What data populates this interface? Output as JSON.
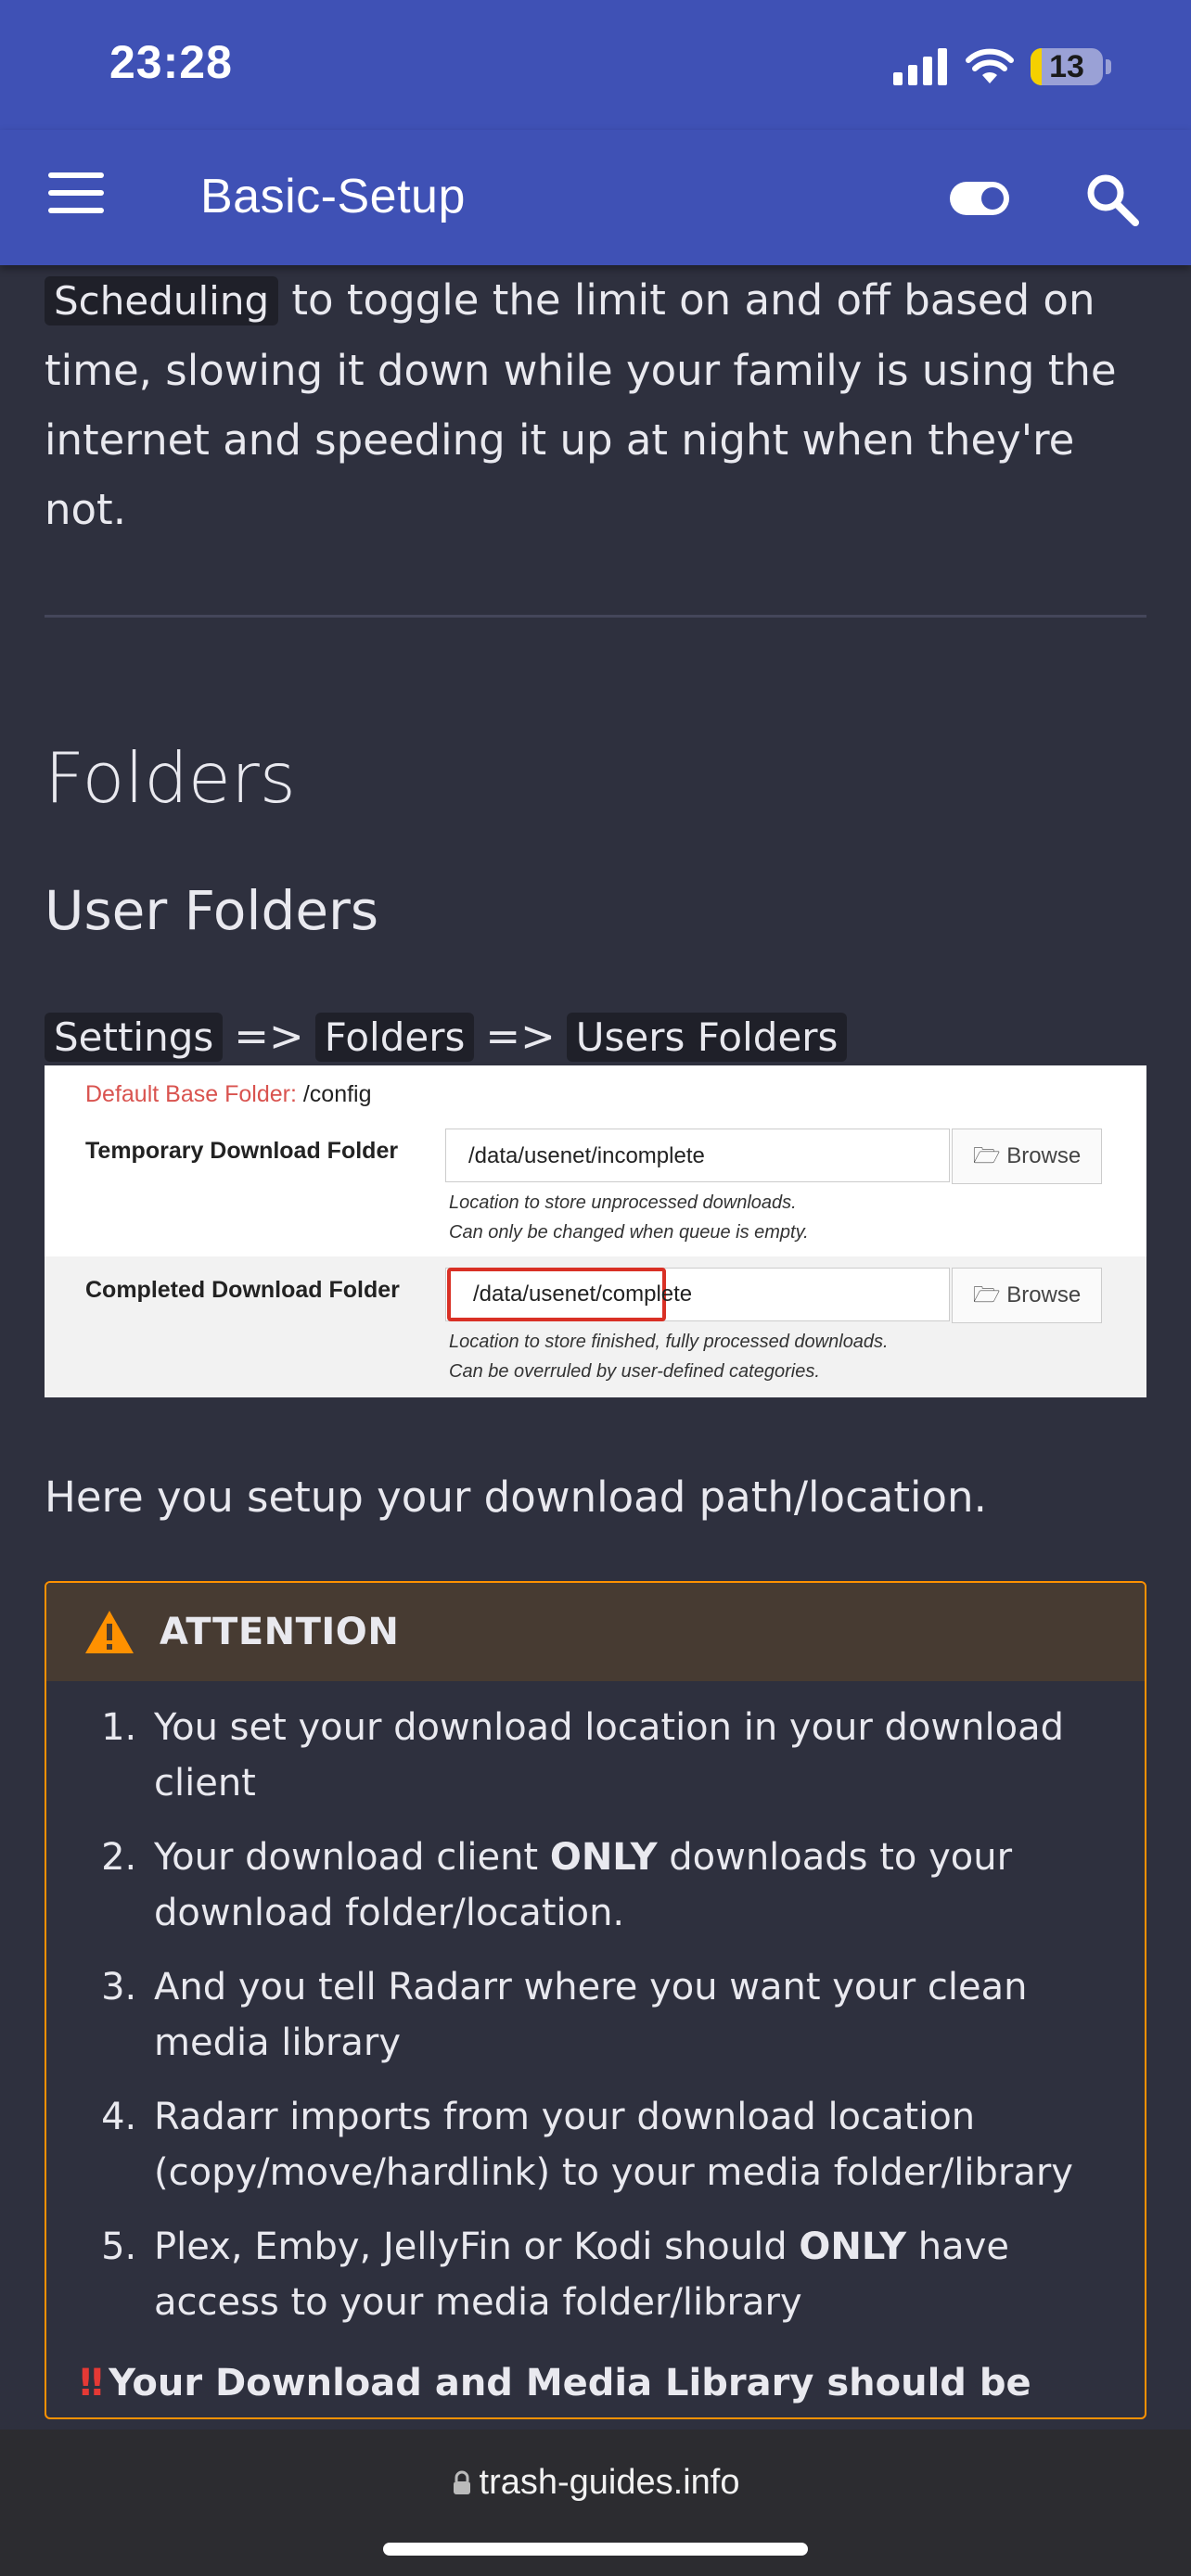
{
  "status": {
    "time": "23:28",
    "battery": "13"
  },
  "appbar": {
    "title": "Basic-Setup"
  },
  "intro": {
    "code_scheduling": "Scheduling",
    "text": " to toggle the limit on and off based on time, slowing it down while your family is using the internet and speeding it up at night when they're not."
  },
  "section": {
    "h1": "Folders",
    "h2": "User Folders"
  },
  "path": {
    "settings": "Settings",
    "folders": "Folders",
    "users_folders": "Users Folders",
    "arrow": "=>"
  },
  "screenshot": {
    "default_label": "Default Base Folder:",
    "default_value": "/config",
    "temp_label": "Temporary Download Folder",
    "temp_value": "/data/usenet/incomplete",
    "temp_help1": "Location to store unprocessed downloads.",
    "temp_help2": "Can only be changed when queue is empty.",
    "complete_label": "Completed Download Folder",
    "complete_value": "/data/usenet/complete",
    "complete_help1": "Location to store finished, fully processed downloads.",
    "complete_help2": "Can be overruled by user-defined categories.",
    "browse": "Browse"
  },
  "para2": "Here you setup your download path/location.",
  "attention": {
    "title": "ATTENTION",
    "items": [
      {
        "pre": "You set your download location in your download client",
        "bold": "",
        "post": ""
      },
      {
        "pre": "Your download client ",
        "bold": "ONLY",
        "post": " downloads to your download folder/location."
      },
      {
        "pre": "And you tell Radarr where you want your clean media library",
        "bold": "",
        "post": ""
      },
      {
        "pre": "Radarr imports from your download location (copy/move/hardlink) to your media folder/library",
        "bold": "",
        "post": ""
      },
      {
        "pre": "Plex, Emby, JellyFin or Kodi should ",
        "bold": "ONLY",
        "post": " have access to your media folder/library"
      }
    ],
    "footer_mark": "‼",
    "footer": "Your Download and Media Library should be **NEVER the same locations**"
  },
  "bottom": {
    "url": "trash-guides.info"
  },
  "colors": {
    "appbar": "#3f51b5",
    "background": "#2e303e",
    "attention_border": "#ff9100"
  }
}
